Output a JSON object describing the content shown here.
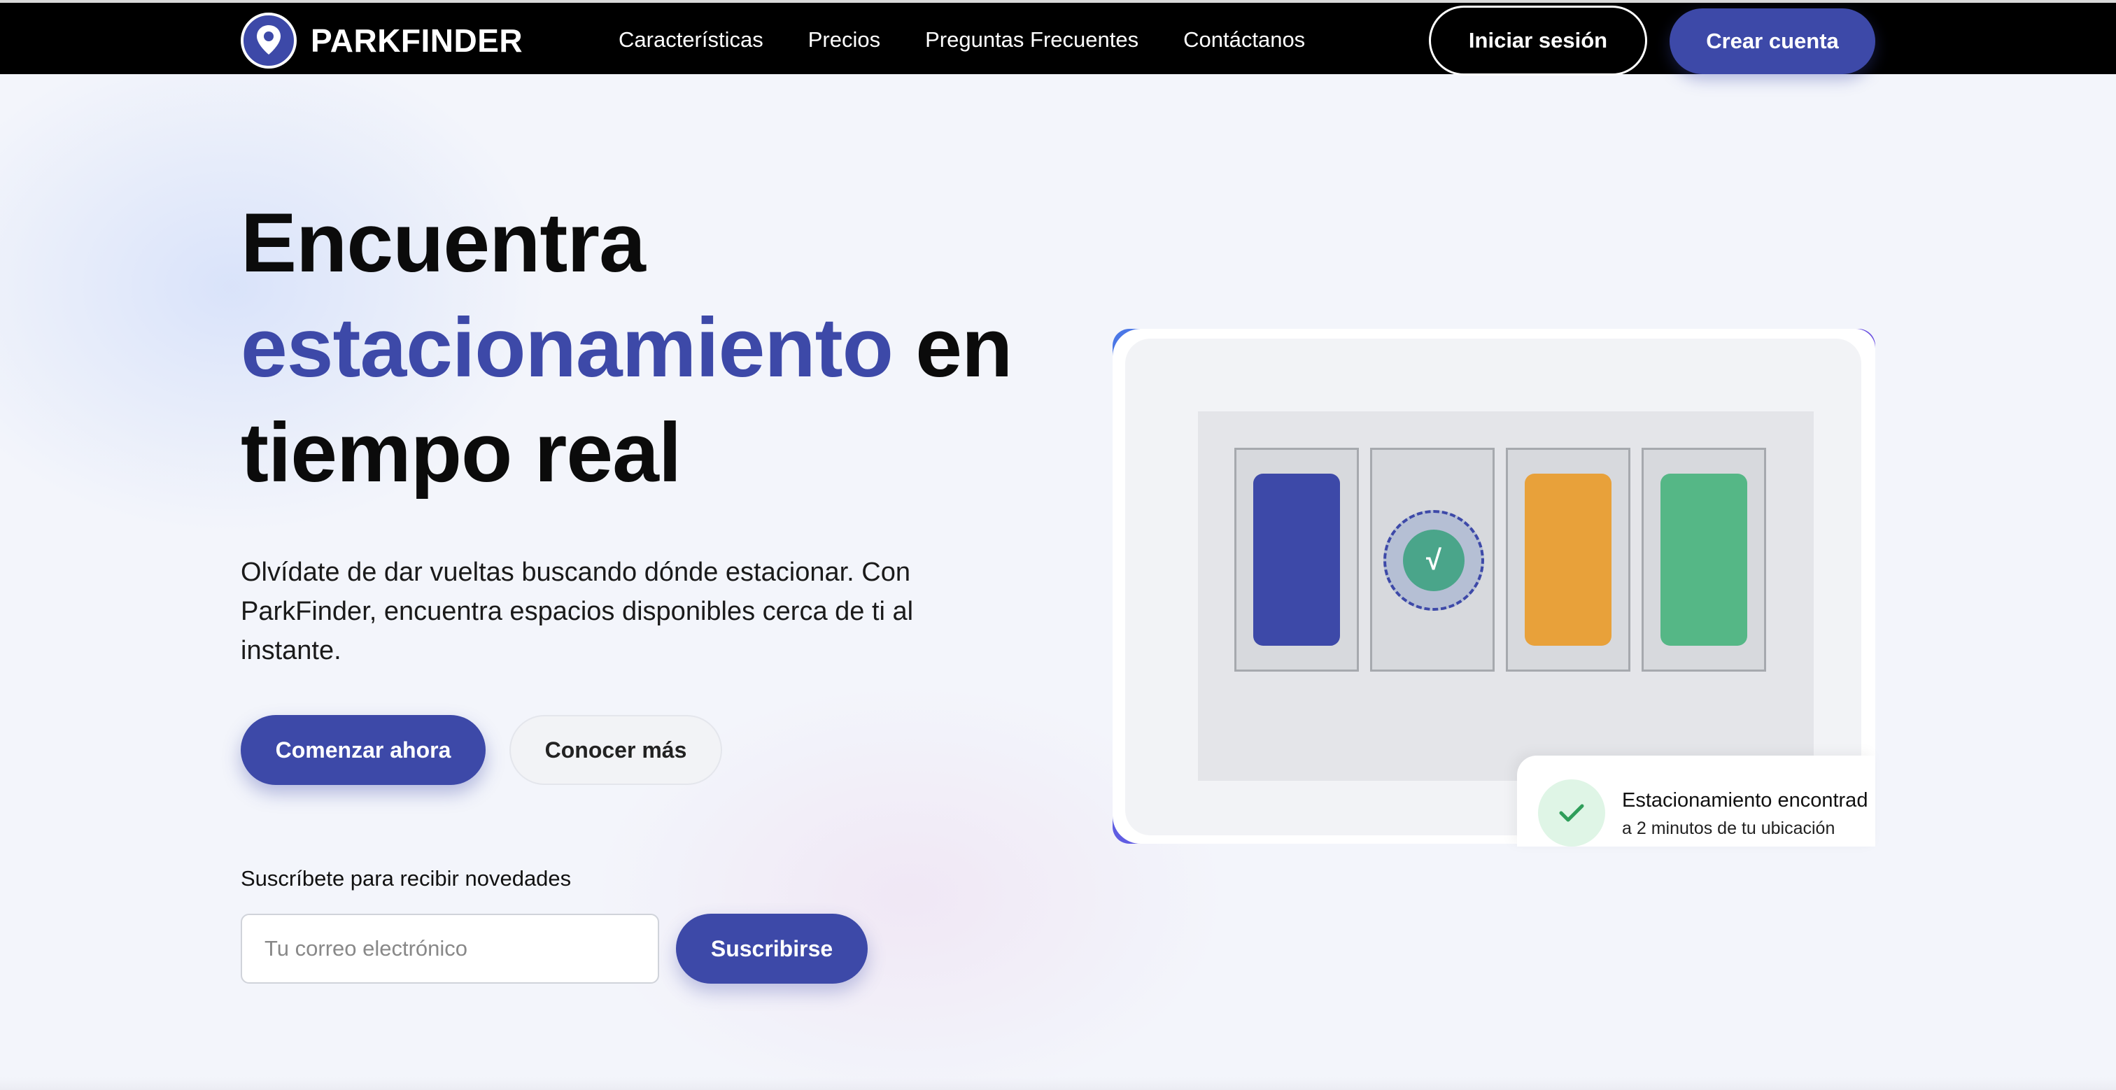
{
  "nav": {
    "brand": "PARKFINDER",
    "links": [
      {
        "label": "Características"
      },
      {
        "label": "Precios"
      },
      {
        "label": "Preguntas Frecuentes"
      },
      {
        "label": "Contáctanos"
      }
    ],
    "login_label": "Iniciar sesión",
    "signup_label": "Crear cuenta"
  },
  "hero": {
    "title_line1": "Encuentra",
    "title_accent": "estacionamiento",
    "title_mid": " en",
    "title_line3": "tiempo real",
    "description": "Olvídate de dar vueltas buscando dónde estacionar. Con ParkFinder, encuentra espacios disponibles cerca de ti al instante.",
    "primary_label": "Comenzar ahora",
    "secondary_label": "Conocer más"
  },
  "subscribe": {
    "label": "Suscríbete para recibir novedades",
    "placeholder": "Tu correo electrónico",
    "button_label": "Suscribirse"
  },
  "illustration": {
    "parking_spaces": [
      {
        "state": "occupied",
        "car_color": "#3d49a8"
      },
      {
        "state": "available-target",
        "marker": "√"
      },
      {
        "state": "occupied",
        "car_color": "#e8a13a"
      },
      {
        "state": "occupied",
        "car_color": "#55b786"
      }
    ],
    "notification": {
      "title": "Estacionamiento encontrad",
      "subtitle": "a 2 minutos de tu ubicación"
    }
  },
  "colors": {
    "accent": "#3d49a8",
    "nav_bg": "#000000",
    "page_bg": "#f3f5fb",
    "success": "#4aa58a"
  }
}
